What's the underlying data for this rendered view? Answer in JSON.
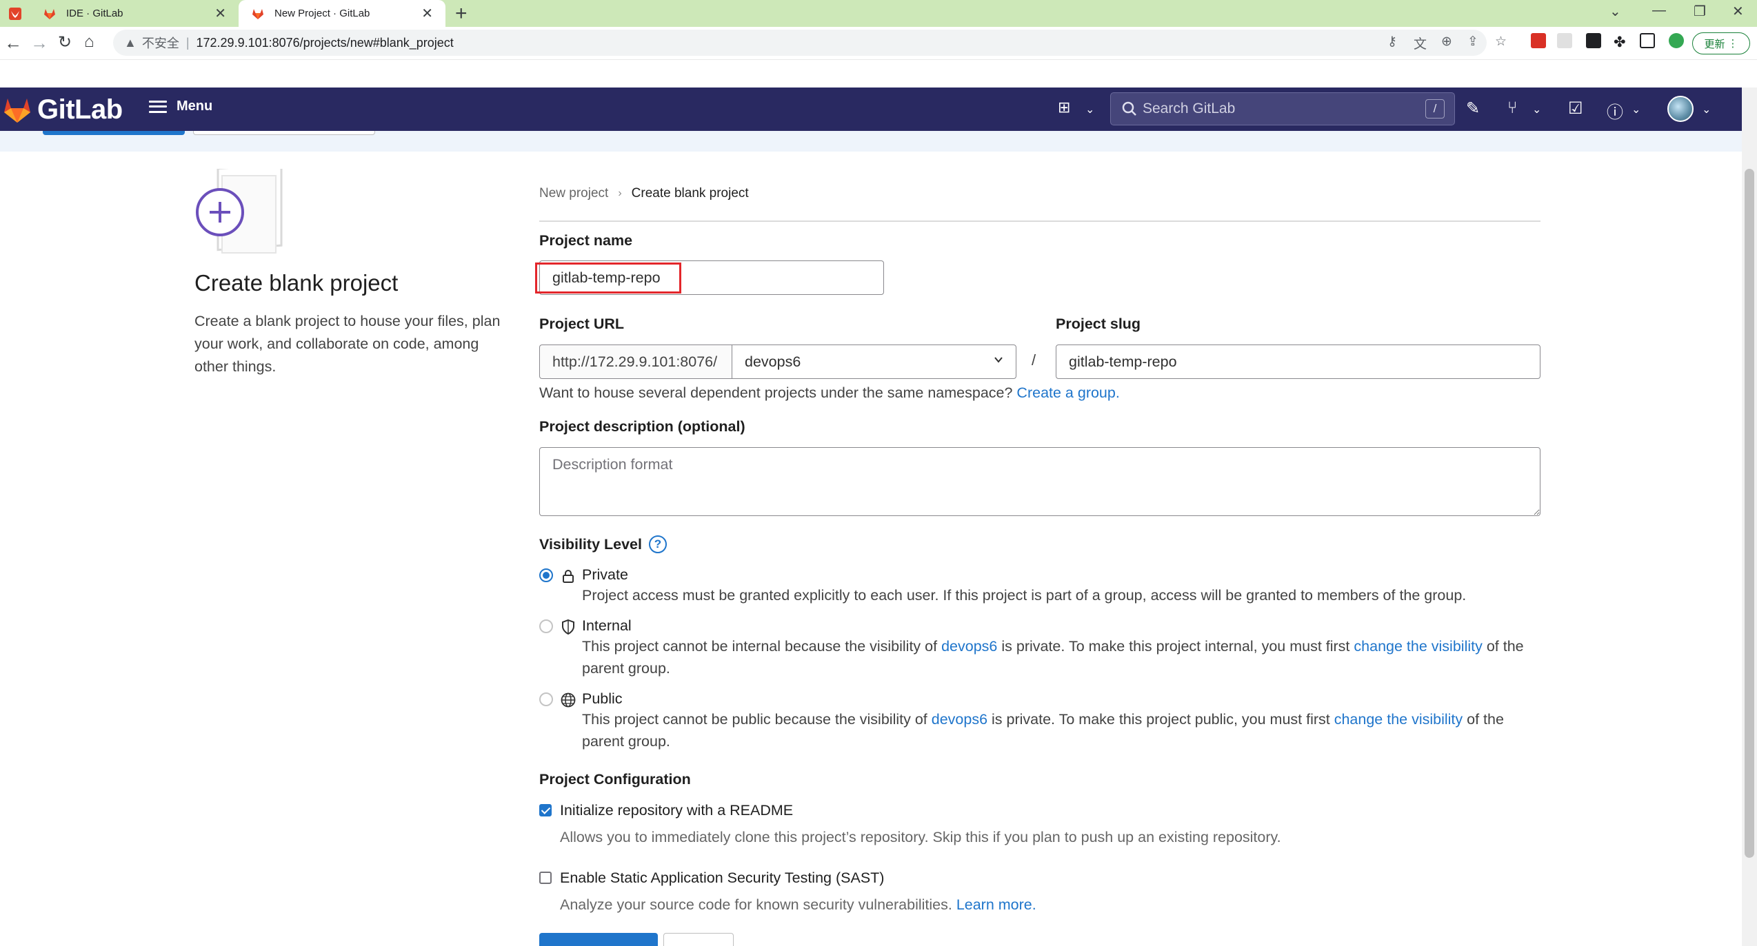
{
  "browser": {
    "tabs": [
      {
        "title": "IDE · GitLab",
        "active": false
      },
      {
        "title": "New Project · GitLab",
        "active": true
      }
    ],
    "address": {
      "security_label": "不安全",
      "url": "172.29.9.101:8076/projects/new#blank_project"
    },
    "update_label": "更新"
  },
  "header": {
    "brand": "GitLab",
    "menu_label": "Menu",
    "search_placeholder": "Search GitLab",
    "search_shortcut": "/"
  },
  "left_panel": {
    "title": "Create blank project",
    "description": "Create a blank project to house your files, plan your work, and collaborate on code, among other things."
  },
  "breadcrumb": {
    "items": [
      "New project",
      "Create blank project"
    ]
  },
  "form": {
    "project_name": {
      "label": "Project name",
      "value": "gitlab-temp-repo"
    },
    "project_url": {
      "label": "Project URL",
      "prefix": "http://172.29.9.101:8076/",
      "namespace": "devops6",
      "separator": "/"
    },
    "project_slug": {
      "label": "Project slug",
      "value": "gitlab-temp-repo"
    },
    "namespace_help": {
      "text": "Want to house several dependent projects under the same namespace?",
      "link": "Create a group."
    },
    "description": {
      "label": "Project description (optional)",
      "placeholder": "Description format"
    },
    "visibility": {
      "label": "Visibility Level",
      "help_icon": "?",
      "options": [
        {
          "title": "Private",
          "icon": "lock-icon",
          "selected": true,
          "description": "Project access must be granted explicitly to each user. If this project is part of a group, access will be granted to members of the group."
        },
        {
          "title": "Internal",
          "icon": "shield-icon",
          "selected": false,
          "desc_1": "This project cannot be internal because the visibility of",
          "group_link": "devops6",
          "desc_2": "is private. To make this project internal, you must first",
          "change_link": "change the visibility",
          "desc_3": "of the parent group."
        },
        {
          "title": "Public",
          "icon": "globe-icon",
          "selected": false,
          "desc_1": "This project cannot be public because the visibility of",
          "group_link": "devops6",
          "desc_2": "is private. To make this project public, you must first",
          "change_link": "change the visibility",
          "desc_3": "of the parent group."
        }
      ]
    },
    "configuration": {
      "label": "Project Configuration",
      "options": [
        {
          "label": "Initialize repository with a README",
          "checked": true,
          "help": "Allows you to immediately clone this project’s repository. Skip this if you plan to push up an existing repository."
        },
        {
          "label": "Enable Static Application Security Testing (SAST)",
          "checked": false,
          "help": "Analyze your source code for known security vulnerabilities.",
          "help_link": "Learn more."
        }
      ]
    }
  },
  "colors": {
    "header_bg": "#292961",
    "link": "#1f75cb",
    "highlight_box": "#e3262b",
    "tab_strip": "#cde8b8"
  }
}
